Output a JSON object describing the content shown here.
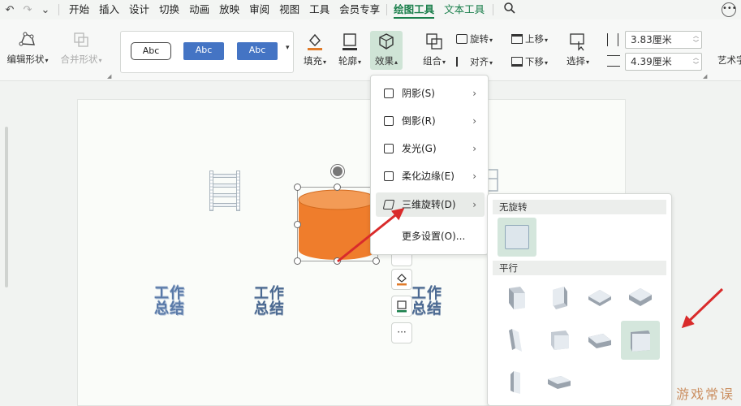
{
  "menubar": {
    "quick_access": [
      "↶",
      "↷",
      "⌄"
    ],
    "tabs": [
      "开始",
      "插入",
      "设计",
      "切换",
      "动画",
      "放映",
      "审阅",
      "视图",
      "工具",
      "会员专享",
      "绘图工具",
      "文本工具"
    ]
  },
  "ribbon": {
    "edit_shape": "编辑形状",
    "merge_shape": "合并形状",
    "style_samples": [
      "Abc",
      "Abc",
      "Abc"
    ],
    "fill": "填充",
    "outline": "轮廓",
    "effects": "效果",
    "combine": "组合",
    "rotate": "旋转",
    "align": "对齐",
    "bring_forward": "上移",
    "send_backward": "下移",
    "select": "选择",
    "height": "3.83厘米",
    "width": "4.39厘米",
    "art_text": "艺术字"
  },
  "slide": {
    "wordart": [
      {
        "line1": "工作",
        "line2": "总结"
      },
      {
        "line1": "工作",
        "line2": "总结"
      },
      {
        "line1": "工作",
        "line2": "总结"
      }
    ],
    "floatbar_more": "···"
  },
  "effects_menu": {
    "items": [
      {
        "label": "阴影(S)"
      },
      {
        "label": "倒影(R)"
      },
      {
        "label": "发光(G)"
      },
      {
        "label": "柔化边缘(E)"
      },
      {
        "label": "三维旋转(D)"
      },
      {
        "label": "更多设置(O)..."
      }
    ]
  },
  "rotation_submenu": {
    "section_no_rotation": "无旋转",
    "section_parallel": "平行"
  },
  "watermark": "游戏常误",
  "colors": {
    "accent": "#1a7f4b",
    "cylinder": "#ef7d2c",
    "arrow": "#d92b2b",
    "style_blue": "#4474c4"
  }
}
